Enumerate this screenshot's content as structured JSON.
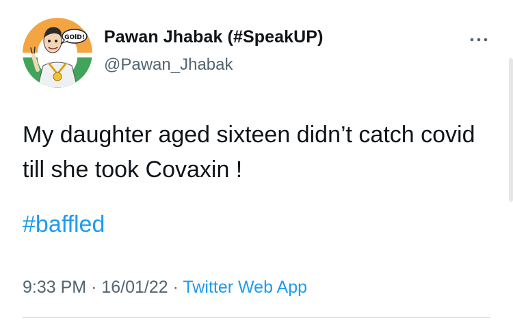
{
  "author": {
    "display_name": "Pawan Jhabak (#SpeakUP)",
    "handle": "@Pawan_Jhabak",
    "avatar_badge_text": "GOlD!"
  },
  "tweet": {
    "text": "My daughter aged sixteen didn’t catch covid till she took Covaxin !",
    "hashtag": "#baffled"
  },
  "meta": {
    "time": "9:33 PM",
    "separator": "·",
    "date": "16/01/22",
    "source": "Twitter Web App"
  },
  "icons": {
    "more": "more-options-icon"
  },
  "colors": {
    "link": "#1d9bf0",
    "secondary_text": "#536471",
    "primary_text": "#0f1419"
  }
}
